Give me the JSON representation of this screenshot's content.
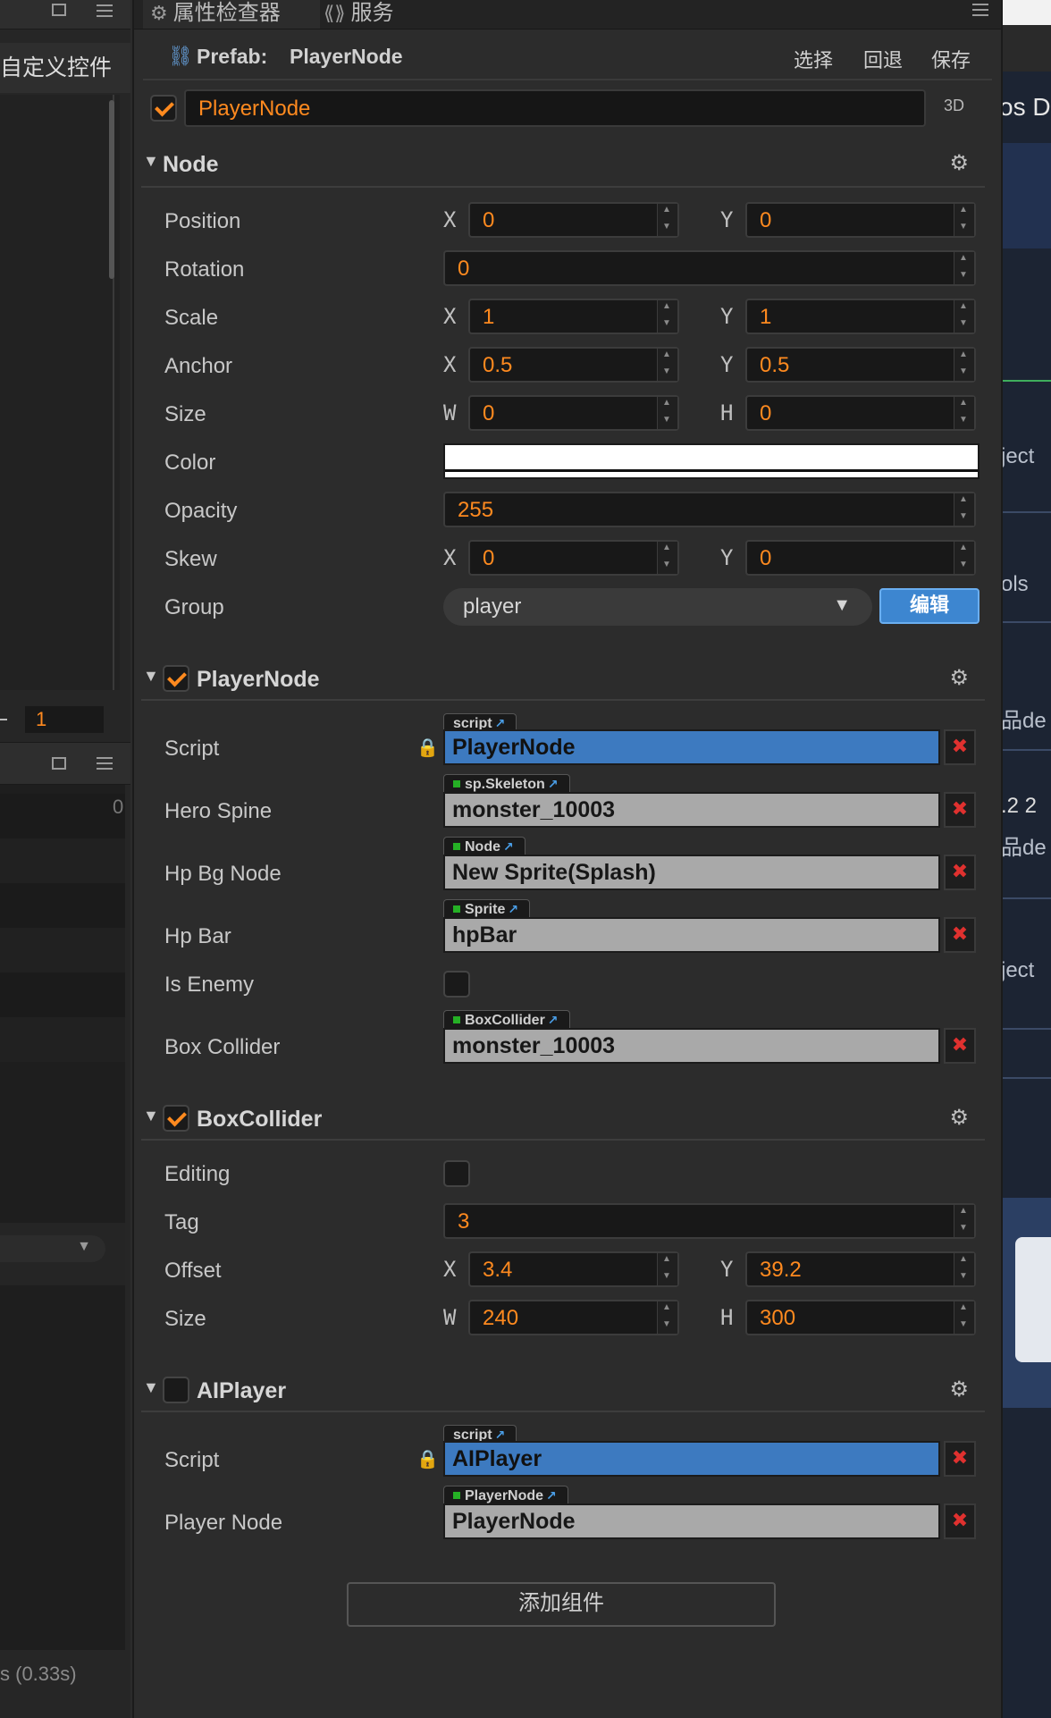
{
  "left": {
    "custom_widget": "自定义控件",
    "value": "1",
    "zero": "0",
    "time": "s (0.33s)"
  },
  "right": {
    "t1": "os Da",
    "t2": "ject",
    "t3": "ols",
    "t4": "品de",
    "t5": ".2 2",
    "t6": "品de",
    "t7": "ject"
  },
  "tabs": [
    {
      "label": "属性检查器",
      "icon": "gear-icon"
    },
    {
      "label": "服务",
      "icon": "service-icon"
    }
  ],
  "prefab": {
    "label": "Prefab:",
    "name": "PlayerNode",
    "select": "选择",
    "revert": "回退",
    "save": "保存"
  },
  "node_name": "PlayerNode",
  "mode_3d": "3D",
  "node": {
    "title": "Node",
    "position": {
      "label": "Position",
      "x": "0",
      "y": "0"
    },
    "rotation": {
      "label": "Rotation",
      "value": "0"
    },
    "scale": {
      "label": "Scale",
      "x": "1",
      "y": "1"
    },
    "anchor": {
      "label": "Anchor",
      "x": "0.5",
      "y": "0.5"
    },
    "size": {
      "label": "Size",
      "w": "0",
      "h": "0"
    },
    "color": {
      "label": "Color",
      "value": "#ffffff"
    },
    "opacity": {
      "label": "Opacity",
      "value": "255"
    },
    "skew": {
      "label": "Skew",
      "x": "0",
      "y": "0"
    },
    "group": {
      "label": "Group",
      "value": "player",
      "edit": "编辑"
    },
    "axis_x": "X",
    "axis_y": "Y",
    "axis_w": "W",
    "axis_h": "H"
  },
  "player_node": {
    "title": "PlayerNode",
    "enabled": true,
    "script": {
      "label": "Script",
      "tag": "script",
      "value": "PlayerNode"
    },
    "hero_spine": {
      "label": "Hero Spine",
      "tag": "sp.Skeleton",
      "value": "monster_10003"
    },
    "hp_bg_node": {
      "label": "Hp Bg Node",
      "tag": "Node",
      "value": "New Sprite(Splash)"
    },
    "hp_bar": {
      "label": "Hp Bar",
      "tag": "Sprite",
      "value": "hpBar"
    },
    "is_enemy": {
      "label": "Is Enemy",
      "checked": false
    },
    "box_collider": {
      "label": "Box Collider",
      "tag": "BoxCollider",
      "value": "monster_10003"
    }
  },
  "box_collider": {
    "title": "BoxCollider",
    "enabled": true,
    "editing": {
      "label": "Editing",
      "checked": false
    },
    "tag": {
      "label": "Tag",
      "value": "3"
    },
    "offset": {
      "label": "Offset",
      "x": "3.4",
      "y": "39.2"
    },
    "size": {
      "label": "Size",
      "w": "240",
      "h": "300"
    }
  },
  "ai_player": {
    "title": "AIPlayer",
    "enabled": false,
    "script": {
      "label": "Script",
      "tag": "script",
      "value": "AIPlayer"
    },
    "player_node": {
      "label": "Player Node",
      "tag": "PlayerNode",
      "value": "PlayerNode"
    }
  },
  "add_component": "添加组件",
  "colors": {
    "accent": "#ff8a1f",
    "script_blue": "#3d7ac0",
    "edit_blue": "#3d86d0",
    "remove_red": "#e0312f"
  }
}
